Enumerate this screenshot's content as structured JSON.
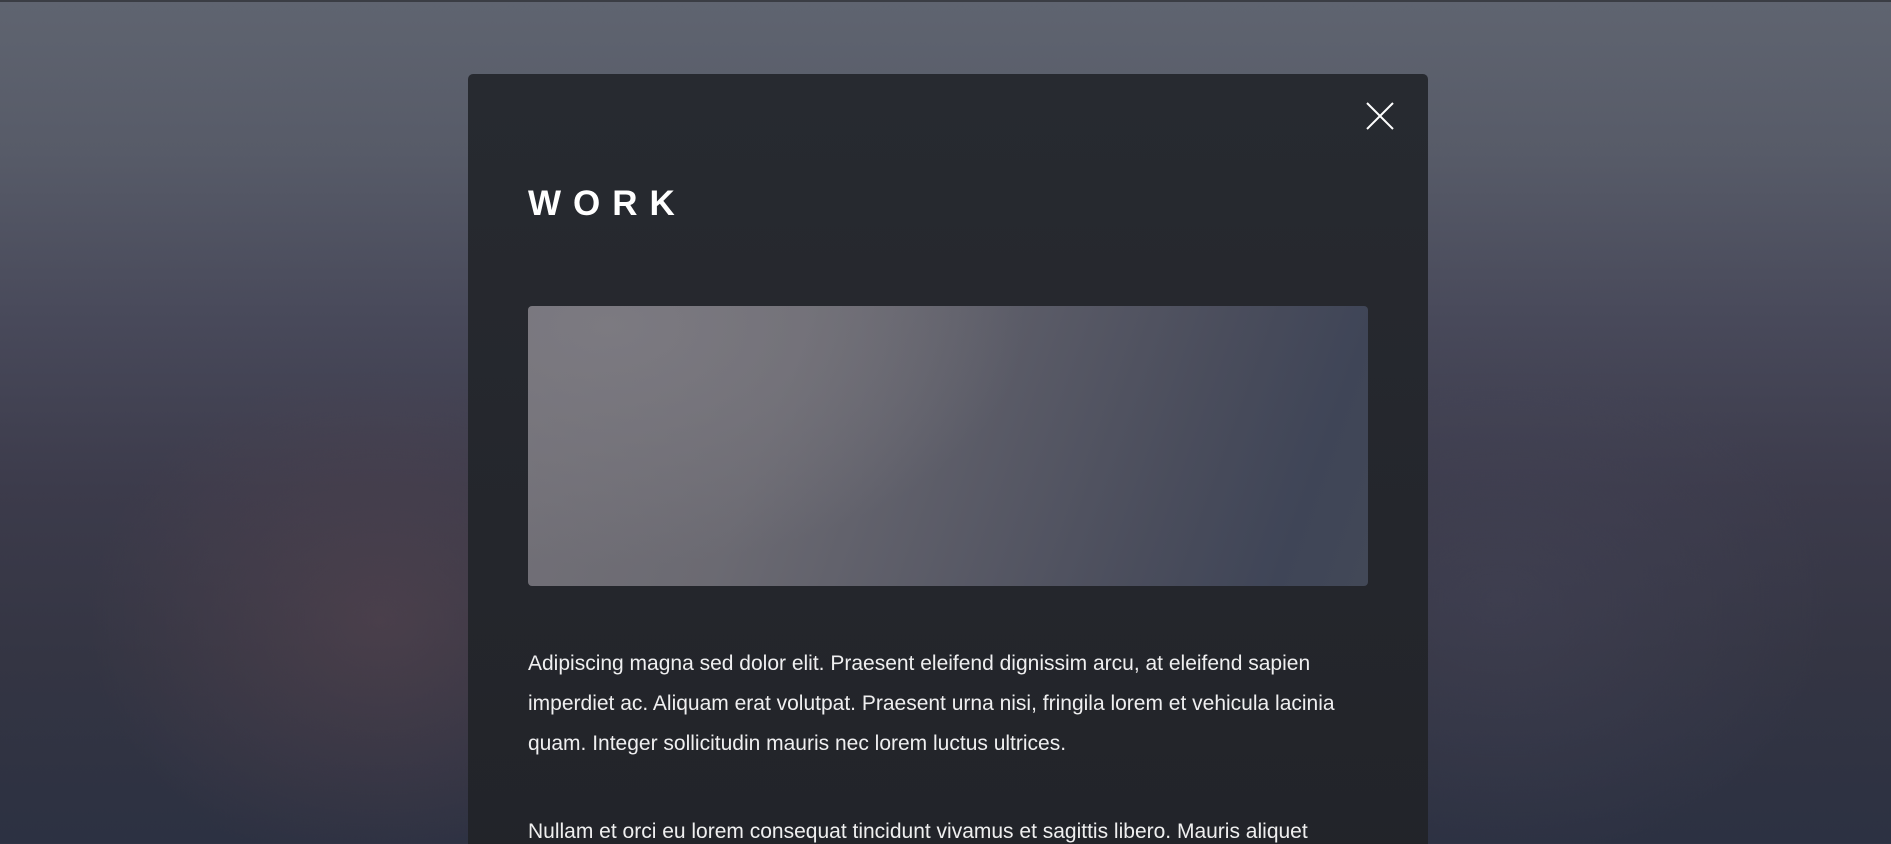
{
  "modal": {
    "title": "WORK",
    "close_icon": "close-icon",
    "image_alt": "work-image",
    "paragraphs": [
      "Adipiscing magna sed dolor elit. Praesent eleifend dignissim arcu, at eleifend sapien imperdiet ac. Aliquam erat volutpat. Praesent urna nisi, fringila lorem et vehicula lacinia quam. Integer sollicitudin mauris nec lorem luctus ultrices.",
      "Nullam et orci eu lorem consequat tincidunt vivamus et sagittis libero. Mauris aliquet"
    ]
  },
  "colors": {
    "modal_background": "#25272d",
    "text": "#ffffff"
  }
}
